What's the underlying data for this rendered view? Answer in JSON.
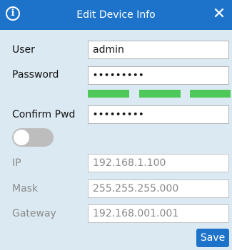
{
  "dialog": {
    "title": "Edit Device Info",
    "info_icon": "info-icon",
    "close_glyph": "✕",
    "accent_color": "#1c73c9",
    "background_color": "#dbe9f2"
  },
  "form": {
    "user": {
      "label": "User",
      "value": "admin"
    },
    "password": {
      "label": "Password",
      "value": "•••••••••"
    },
    "password_strength": {
      "segments": 3,
      "filled": 3,
      "color": "#4fc85a"
    },
    "confirm": {
      "label": "Confirm Pwd",
      "value": "•••••••••"
    },
    "dhcp_toggle": {
      "on": false
    },
    "ip": {
      "label": "IP",
      "value": "192.168.1.100"
    },
    "mask": {
      "label": "Mask",
      "value": "255.255.255.000"
    },
    "gateway": {
      "label": "Gateway",
      "value": "192.168.001.001"
    }
  },
  "actions": {
    "save_label": "Save"
  }
}
